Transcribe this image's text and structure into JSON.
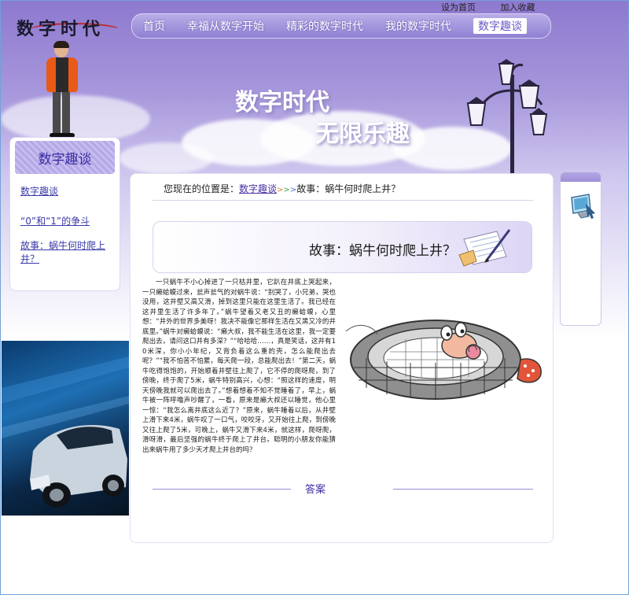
{
  "top_links": {
    "set_home": "设为首页",
    "add_favorite": "加入收藏"
  },
  "logo": {
    "text": "数字时代"
  },
  "nav": {
    "items": [
      {
        "label": "首页"
      },
      {
        "label": "幸福从数字开始"
      },
      {
        "label": "精彩的数字时代"
      },
      {
        "label": "我的数字时代"
      },
      {
        "label": "数字趣谈"
      }
    ],
    "active_index": 4
  },
  "banner": {
    "line1": "数字时代",
    "line2": "无限乐趣"
  },
  "sidebar": {
    "title": "数字趣谈",
    "links": [
      {
        "label": "数字趣谈"
      },
      {
        "label": "“0”和“1”的争斗"
      },
      {
        "label": "故事：蜗牛何时爬上井？"
      }
    ]
  },
  "breadcrumb": {
    "prefix": "您现在的位置是：",
    "link": "数字趣谈",
    "arrows": ">>>",
    "current": "故事：蜗牛何时爬上井？"
  },
  "article": {
    "title": "故事：蜗牛何时爬上井？",
    "body": "一只蜗牛不小心掉进了一只枯井里，它趴在井底上哭起来，一只癞蛤蟆过来，瓮声瓮气的对蜗牛说：“别哭了，小兄弟，哭也没用，这井壁又高又滑，掉到这里只能在这里生活了。我已经在这井里生活了许多年了。”蜗牛望着又老又丑的癞蛤蟆，心里想：“井外的世界多美呀！我决不能像它那样生活在又黑又冷的井底里。”蜗牛对癞蛤蟆说：“癞大叔，我不能生活在这里，我一定要爬出去，请问这口井有多深？”“哈哈哈……，真是笑话，这井有10米深，你小小年纪，又背负着这么重的壳，怎么能爬出去呢？”“我不怕苦不怕累，每天爬一段，总能爬出去！”第二天，蜗牛吃得饱饱的，开始顺着井壁往上爬了，它不停的爬呀爬，到了傍晚，终于爬了5米，蜗牛特别高兴，心想：“照这样的速度，明天傍晚我就可以爬出去了。”想着想着不知不觉睡着了，早上，蜗牛被一阵呼噜声吵醒了，一看，原来是癞大叔还以睡觉，他心里一惊：“我怎么离井底这么近了？”原来，蜗牛睡着以后，从井壁上滑下来4米，蜗牛叹了一口气，咬咬牙，又开始往上爬，到傍晚又往上爬了5米，可晚上，蜗牛又滑下来4米，就这样，爬呀爬，滑呀滑，最后坚强的蜗牛终于爬上了井台。聪明的小朋友你能猜出来蜗牛用了多少天才爬上井台的吗？",
    "answer_label": "答案"
  },
  "colors": {
    "header_purple": "#8d79cf",
    "nav_active_text": "#6a58c4",
    "link_blue": "#3a3aa8",
    "accent_line": "#9b8dd6"
  },
  "icons": {
    "right_box": "computer-monitor-icon",
    "title_decoration": "notepad-pen-icon"
  }
}
